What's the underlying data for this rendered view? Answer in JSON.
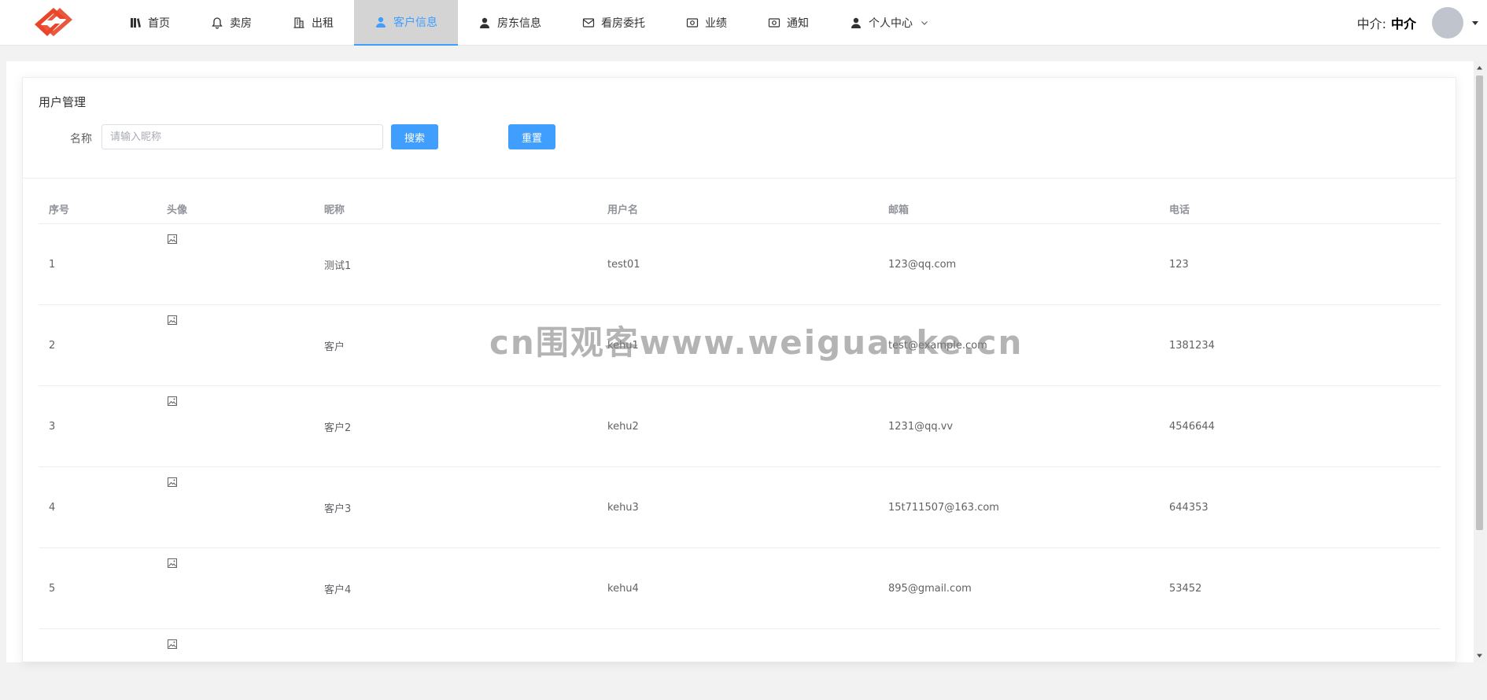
{
  "theme": {
    "accent": "#409eff",
    "logo": "#e8452a",
    "active_bg": "#d4d4d4"
  },
  "nav": {
    "items": [
      {
        "label": "首页",
        "icon": "book-icon"
      },
      {
        "label": "卖房",
        "icon": "bell-icon"
      },
      {
        "label": "出租",
        "icon": "building-icon"
      },
      {
        "label": "客户信息",
        "icon": "user-icon",
        "active": true
      },
      {
        "label": "房东信息",
        "icon": "user-icon"
      },
      {
        "label": "看房委托",
        "icon": "mail-icon"
      },
      {
        "label": "业绩",
        "icon": "money-icon"
      },
      {
        "label": "通知",
        "icon": "money-icon"
      },
      {
        "label": "个人中心",
        "icon": "user-icon",
        "dropdown": true
      }
    ]
  },
  "user": {
    "label": "中介:",
    "role": "中介"
  },
  "card": {
    "title": "用户管理",
    "filter": {
      "label": "名称",
      "placeholder": "请输入昵称",
      "value": "",
      "search_label": "搜索",
      "reset_label": "重置"
    }
  },
  "table": {
    "columns": [
      "序号",
      "头像",
      "昵称",
      "用户名",
      "邮箱",
      "电话"
    ],
    "rows": [
      {
        "index": "1",
        "nickname": "测试1",
        "username": "test01",
        "email": "123@qq.com",
        "phone": "123"
      },
      {
        "index": "2",
        "nickname": "客户",
        "username": "kehu1",
        "email": "test@example.com",
        "phone": "1381234"
      },
      {
        "index": "3",
        "nickname": "客户2",
        "username": "kehu2",
        "email": "1231@qq.vv",
        "phone": "4546644"
      },
      {
        "index": "4",
        "nickname": "客户3",
        "username": "kehu3",
        "email": "15t711507@163.com",
        "phone": "644353"
      },
      {
        "index": "5",
        "nickname": "客户4",
        "username": "kehu4",
        "email": "895@gmail.com",
        "phone": "53452"
      },
      {
        "index": "",
        "nickname": "",
        "username": "",
        "email": "",
        "phone": ""
      }
    ]
  },
  "watermark": "cn围观客www.weiguanke.cn"
}
